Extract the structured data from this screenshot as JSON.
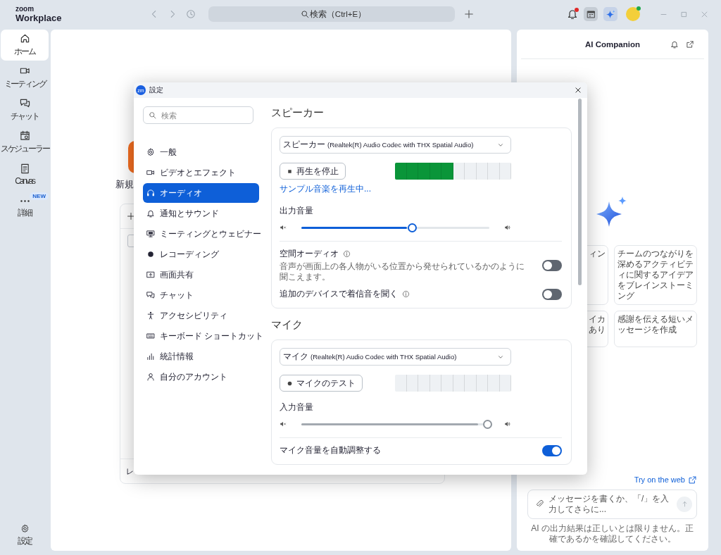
{
  "app": {
    "brand": "zoom",
    "product": "Workplace"
  },
  "toolbar": {
    "search": {
      "placeholder": "検索（Ctrl+E）"
    },
    "notifications_unread": true
  },
  "rail": {
    "items": [
      {
        "label": "ホーム",
        "selected": true
      },
      {
        "label": "ミーティング",
        "selected": false
      },
      {
        "label": "チャット",
        "selected": false
      },
      {
        "label": "スケジューラー",
        "selected": false
      },
      {
        "label": "Canvas",
        "selected": false
      },
      {
        "label": "詳細",
        "selected": false,
        "badge": "NEW"
      }
    ],
    "footer": {
      "label": "設定"
    }
  },
  "home": {
    "new_label": "新規",
    "list_footer": "レ",
    "row_checkbox": {
      "checked": false
    }
  },
  "ai_panel": {
    "title": "AI Companion",
    "suggestions": [
      {
        "kind": "clipped",
        "lines": [
          "ィン"
        ]
      },
      {
        "kind": "full",
        "lines": [
          "チームのつながりを深めるアクティビティに関するアイデアをブレインストーミング"
        ]
      },
      {
        "kind": "clipped",
        "lines": [
          "イカ",
          "あり"
        ]
      },
      {
        "kind": "full",
        "lines": [
          "感謝を伝える短いメッセージを作成"
        ]
      }
    ],
    "try_link": "Try on the web",
    "message": {
      "placeholder": "メッセージを書くか、「/」を入力してさらに..."
    },
    "disclaimer": "AI の出力結果は正しいとは限りません。正確であるかを確認してください。"
  },
  "settings": {
    "badge": "zm",
    "title": "設定",
    "search": {
      "placeholder": "検索"
    },
    "nav": [
      {
        "label": "一般",
        "selected": false
      },
      {
        "label": "ビデオとエフェクト",
        "selected": false
      },
      {
        "label": "オーディオ",
        "selected": true
      },
      {
        "label": "通知とサウンド",
        "selected": false
      },
      {
        "label": "ミーティングとウェビナー",
        "selected": false
      },
      {
        "label": "レコーディング",
        "selected": false
      },
      {
        "label": "画面共有",
        "selected": false
      },
      {
        "label": "チャット",
        "selected": false
      },
      {
        "label": "アクセシビリティ",
        "selected": false
      },
      {
        "label": "キーボード ショートカット",
        "selected": false
      },
      {
        "label": "統計情報",
        "selected": false
      },
      {
        "label": "自分のアカウント",
        "selected": false
      }
    ],
    "sections": [
      {
        "heading": "スピーカー",
        "device": {
          "name": "スピーカー",
          "detail": "(Realtek(R) Audio Codec with THX Spatial Audio)"
        },
        "test_button": {
          "kind": "stop",
          "label": "再生を停止"
        },
        "meter": {
          "level": 0.5
        },
        "status_link": "サンプル音楽を再生中...",
        "volume": {
          "label": "出力音量",
          "level": 0.56,
          "disabled": false
        },
        "options": [
          {
            "label": "空間オーディオ",
            "info": true,
            "description": "音声が画面上の各人物がいる位置から発せられているかのように聞こえます。",
            "on": false
          },
          {
            "label": "追加のデバイスで着信音を聞く",
            "info": true,
            "on": false
          }
        ]
      },
      {
        "heading": "マイク",
        "device": {
          "name": "マイク",
          "detail": "(Realtek(R) Audio Codec with THX Spatial Audio)"
        },
        "test_button": {
          "kind": "record",
          "label": "マイクのテスト"
        },
        "meter": {
          "level": 0
        },
        "volume": {
          "label": "入力音量",
          "level": 0.94,
          "disabled": true
        },
        "options": [
          {
            "label": "マイク音量を自動調整する",
            "info": false,
            "on": true
          }
        ]
      }
    ]
  }
}
